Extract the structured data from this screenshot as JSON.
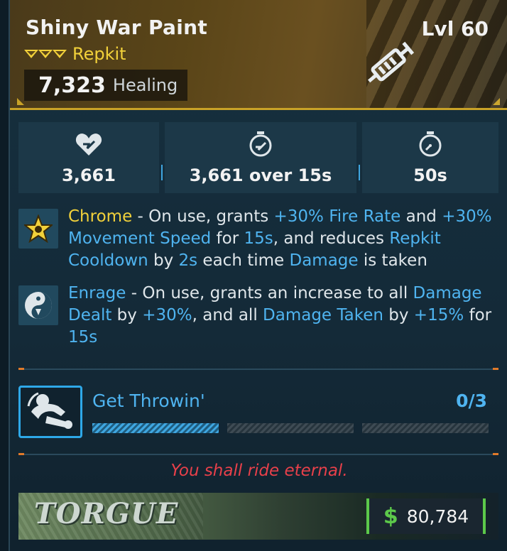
{
  "item": {
    "name": "Shiny War Paint",
    "level": "Lvl 60",
    "type": "Repkit",
    "healing_value": "7,323",
    "healing_label": "Healing",
    "rarity_color": "#f2d13a"
  },
  "stats": [
    {
      "icon": "heart-icon",
      "value": "3,661"
    },
    {
      "icon": "stopwatch-heal-icon",
      "value": "3,661 over 15s"
    },
    {
      "icon": "stopwatch-icon",
      "value": "50s"
    }
  ],
  "perks": {
    "chrome": {
      "icon": "chrome-star-icon",
      "name": "Chrome",
      "t1": " - On use, grants ",
      "k1": "+30% Fire Rate",
      "t2": " and ",
      "k2": "+30% Movement Speed",
      "t3": " for ",
      "k3": "15s",
      "t4": ", and reduces ",
      "k4": "Repkit Cooldown",
      "t5": " by ",
      "k5": "2s",
      "t6": " each time ",
      "k6": "Damage",
      "t7": " is taken"
    },
    "enrage": {
      "icon": "enrage-yin-yang-icon",
      "name": "Enrage",
      "t1": " - On use, grants an increase to all ",
      "k1": "Damage Dealt",
      "t2": " by ",
      "k2": "+30%",
      "t3": ", and all ",
      "k3": "Damage Taken",
      "t4": " by ",
      "k4": "+15%",
      "t5": " for ",
      "k5": "15s"
    }
  },
  "challenge": {
    "icon": "throw-grenade-icon",
    "title": "Get Throwin'",
    "progress": "0/3",
    "progress_fraction": 0.33
  },
  "flavor_text": "You shall ride eternal.",
  "footer": {
    "manufacturer": "TORGUE",
    "currency_icon": "dollar-icon",
    "currency_symbol": "$",
    "price": "80,784"
  },
  "colors": {
    "keyword_yellow": "#f2d13a",
    "keyword_blue": "#4fb4f0",
    "flavor_red": "#e8404a",
    "money_green": "#5cc94a"
  }
}
